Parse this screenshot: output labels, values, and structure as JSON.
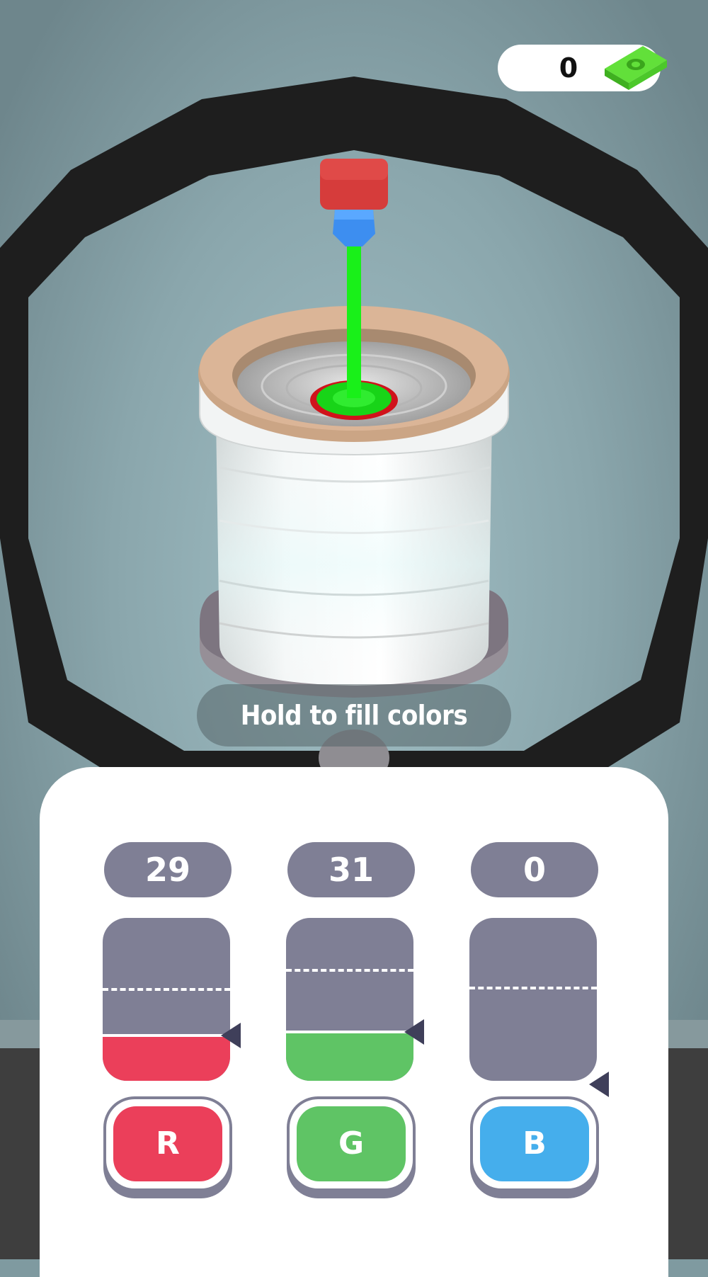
{
  "hud": {
    "money": "0",
    "money_icon": "cash-stack-icon"
  },
  "hint": "Hold to fill colors",
  "colors": {
    "red": "#eb3f5a",
    "green": "#5fc465",
    "blue": "#45aeec",
    "stream": "#19f019"
  },
  "channels": [
    {
      "id": "red",
      "count": "29",
      "button_label": "R",
      "fill_level": 0.28,
      "target_level": 0.55
    },
    {
      "id": "green",
      "count": "31",
      "button_label": "G",
      "fill_level": 0.3,
      "target_level": 0.67
    },
    {
      "id": "blue",
      "count": "0",
      "button_label": "B",
      "fill_level": 0.0,
      "target_level": 0.56
    }
  ]
}
